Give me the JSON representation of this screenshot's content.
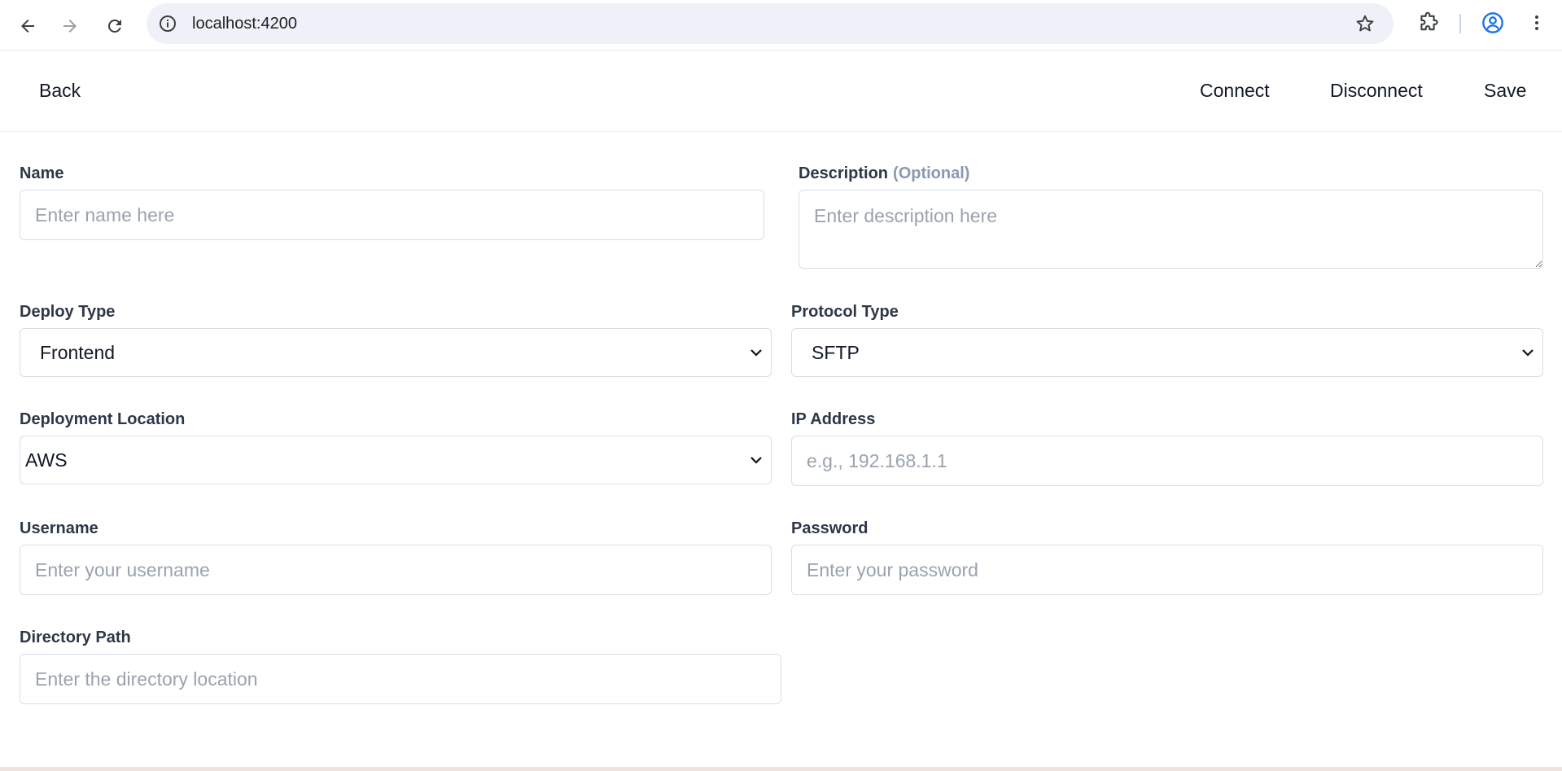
{
  "browser": {
    "url": "localhost:4200"
  },
  "header": {
    "back_label": "Back",
    "connect_label": "Connect",
    "disconnect_label": "Disconnect",
    "save_label": "Save"
  },
  "form": {
    "name": {
      "label": "Name",
      "placeholder": "Enter name here",
      "value": ""
    },
    "description": {
      "label": "Description",
      "optional_tag": "(Optional)",
      "placeholder": "Enter description here",
      "value": ""
    },
    "deploy_type": {
      "label": "Deploy Type",
      "selected": "Frontend"
    },
    "protocol_type": {
      "label": "Protocol Type",
      "selected": "SFTP"
    },
    "deployment_location": {
      "label": "Deployment Location",
      "selected": "AWS"
    },
    "ip_address": {
      "label": "IP Address",
      "placeholder": "e.g., 192.168.1.1",
      "value": ""
    },
    "username": {
      "label": "Username",
      "placeholder": "Enter your username",
      "value": ""
    },
    "password": {
      "label": "Password",
      "placeholder": "Enter your password",
      "value": ""
    },
    "directory_path": {
      "label": "Directory Path",
      "placeholder": "Enter the directory location",
      "value": ""
    }
  },
  "icons": {
    "back": "arrow-left-icon",
    "forward": "arrow-right-icon",
    "reload": "reload-icon",
    "site_info": "info-icon",
    "bookmark": "star-icon",
    "extensions": "puzzle-icon",
    "profile": "profile-icon",
    "menu": "kebab-menu-icon",
    "select": "chevron-down-icon"
  },
  "colors": {
    "label": "#2d3748",
    "placeholder": "#9aa3ae",
    "optional": "#8a99ad",
    "border": "#d9dee5",
    "profile_accent": "#1a73e8"
  }
}
